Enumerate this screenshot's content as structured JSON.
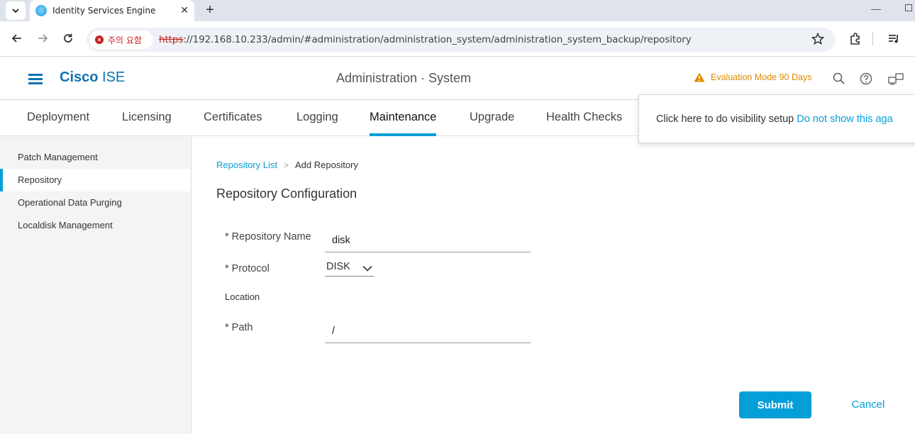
{
  "browser": {
    "tab_title": "Identity Services Engine",
    "tab_close": "✕",
    "new_tab": "+",
    "security_chip": "주의 요함",
    "url_scheme": "https",
    "url_rest": "://192.168.10.233/admin/#administration/administration_system/administration_system_backup/repository",
    "window_min": "—"
  },
  "header": {
    "brand_bold": "Cisco",
    "brand_light": " ISE",
    "title": "Administration · System",
    "eval_mode": "Evaluation Mode 90 Days",
    "warning_color": "#e08a00",
    "brand_color": "#0d74b1"
  },
  "tabs": [
    {
      "label": "Deployment"
    },
    {
      "label": "Licensing"
    },
    {
      "label": "Certificates"
    },
    {
      "label": "Logging"
    },
    {
      "label": "Maintenance",
      "active": true
    },
    {
      "label": "Upgrade"
    },
    {
      "label": "Health Checks"
    }
  ],
  "popover": {
    "text": "Click here to do visibility setup",
    "link": "Do not show this aga"
  },
  "sidebar": {
    "items": [
      {
        "label": "Patch Management"
      },
      {
        "label": "Repository",
        "active": true
      },
      {
        "label": "Operational Data Purging"
      },
      {
        "label": "Localdisk Management"
      }
    ]
  },
  "breadcrumb": {
    "parent": "Repository List",
    "separator": ">",
    "current": "Add Repository"
  },
  "form": {
    "title": "Repository Configuration",
    "repo_name_label": "* Repository Name",
    "repo_name_value": "disk",
    "protocol_label": "* Protocol",
    "protocol_value": "DISK",
    "location_label": "Location",
    "path_label": "* Path",
    "path_value": "/",
    "submit_label": "Submit",
    "cancel_label": "Cancel"
  },
  "colors": {
    "accent": "#049fd9",
    "error": "#c5221f"
  }
}
